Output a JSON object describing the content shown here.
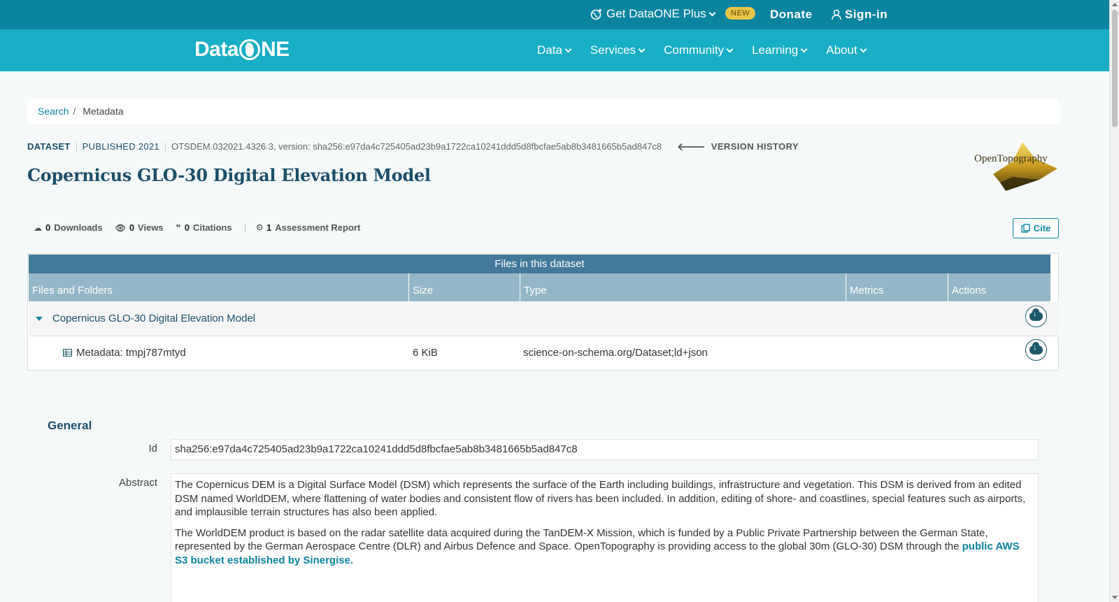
{
  "topbar": {
    "plus_label": "Get DataONE Plus",
    "new_badge": "NEW",
    "donate": "Donate",
    "signin": "Sign-in"
  },
  "nav": {
    "logo_left": "Data",
    "logo_right": "NE",
    "items": [
      {
        "label": "Data"
      },
      {
        "label": "Services"
      },
      {
        "label": "Community"
      },
      {
        "label": "Learning"
      },
      {
        "label": "About"
      }
    ]
  },
  "breadcrumb": {
    "link": "Search",
    "sep": "/",
    "current": "Metadata"
  },
  "dataset": {
    "type": "DATASET",
    "published": "PUBLISHED 2021",
    "pid": "OTSDEM.032021.4326.3, version: sha256:e97da4c725405ad23b9a1722ca10241ddd5d8fbcfae5ab8b3481665b5ad847c8",
    "version_history": "VERSION HISTORY",
    "title": "Copernicus GLO-30 Digital Elevation Model",
    "org_logo": "OpenTopography"
  },
  "stats": {
    "downloads_count": "0",
    "downloads_label": "Downloads",
    "views_count": "0",
    "views_label": "Views",
    "citations_count": "0",
    "citations_label": "Citations",
    "assessment_count": "1",
    "assessment_label": "Assessment Report",
    "cite_label": "Cite"
  },
  "files": {
    "caption": "Files in this dataset",
    "columns": [
      "Files and Folders",
      "Size",
      "Type",
      "Metrics",
      "Actions"
    ],
    "rows": [
      {
        "name": "Copernicus GLO-30 Digital Elevation Model",
        "size": "",
        "type": ""
      },
      {
        "name": "Metadata: tmpj787mtyd",
        "size": "6 KiB",
        "type": "science-on-schema.org/Dataset;ld+json"
      }
    ]
  },
  "general": {
    "heading": "General",
    "id_label": "Id",
    "id_value": "sha256:e97da4c725405ad23b9a1722ca10241ddd5d8fbcfae5ab8b3481665b5ad847c8",
    "abstract_label": "Abstract",
    "abstract_p1": "The Copernicus DEM is a Digital Surface Model (DSM) which represents the surface of the Earth including buildings, infrastructure and vegetation. This DSM is derived from an edited DSM named WorldDEM, where flattening of water bodies and consistent flow of rivers has been included. In addition, editing of shore- and coastlines, special features such as airports, and implausible terrain structures has also been applied.",
    "abstract_p2": "The WorldDEM product is based on the radar satellite data acquired during the TanDEM-X Mission, which is funded by a Public Private Partnership between the German State, represented by the German Aerospace Centre (DLR) and Airbus Defence and Space. OpenTopography is providing access to the global 30m (GLO-30) DSM through the ",
    "abstract_link": "public AWS S3 bucket established by Sinergise."
  },
  "colors": {
    "topbar": "#0b84a0",
    "navbar": "#18aec5",
    "title": "#1c4f6b",
    "table_caption": "#43799a",
    "table_header": "#95b6c6"
  }
}
